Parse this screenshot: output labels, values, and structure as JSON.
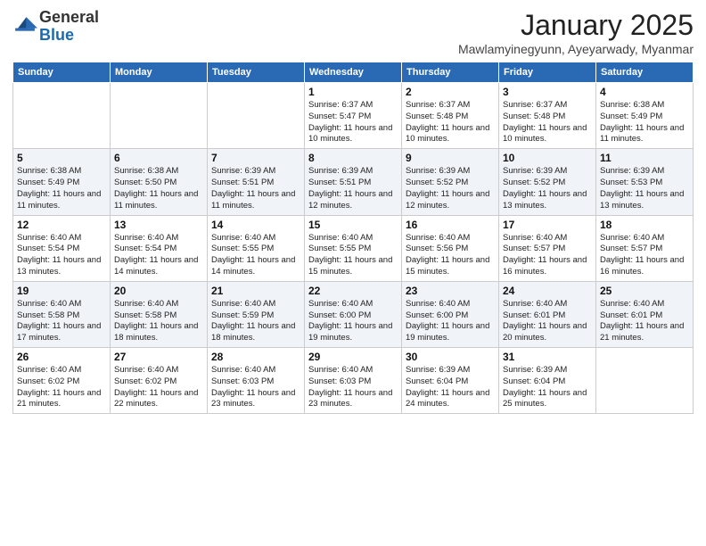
{
  "header": {
    "logo": {
      "general": "General",
      "blue": "Blue"
    },
    "title": "January 2025",
    "location": "Mawlamyinegyunn, Ayeyarwady, Myanmar"
  },
  "days_of_week": [
    "Sunday",
    "Monday",
    "Tuesday",
    "Wednesday",
    "Thursday",
    "Friday",
    "Saturday"
  ],
  "weeks": [
    [
      {
        "day": "",
        "info": ""
      },
      {
        "day": "",
        "info": ""
      },
      {
        "day": "",
        "info": ""
      },
      {
        "day": "1",
        "info": "Sunrise: 6:37 AM\nSunset: 5:47 PM\nDaylight: 11 hours and 10 minutes."
      },
      {
        "day": "2",
        "info": "Sunrise: 6:37 AM\nSunset: 5:48 PM\nDaylight: 11 hours and 10 minutes."
      },
      {
        "day": "3",
        "info": "Sunrise: 6:37 AM\nSunset: 5:48 PM\nDaylight: 11 hours and 10 minutes."
      },
      {
        "day": "4",
        "info": "Sunrise: 6:38 AM\nSunset: 5:49 PM\nDaylight: 11 hours and 11 minutes."
      }
    ],
    [
      {
        "day": "5",
        "info": "Sunrise: 6:38 AM\nSunset: 5:49 PM\nDaylight: 11 hours and 11 minutes."
      },
      {
        "day": "6",
        "info": "Sunrise: 6:38 AM\nSunset: 5:50 PM\nDaylight: 11 hours and 11 minutes."
      },
      {
        "day": "7",
        "info": "Sunrise: 6:39 AM\nSunset: 5:51 PM\nDaylight: 11 hours and 11 minutes."
      },
      {
        "day": "8",
        "info": "Sunrise: 6:39 AM\nSunset: 5:51 PM\nDaylight: 11 hours and 12 minutes."
      },
      {
        "day": "9",
        "info": "Sunrise: 6:39 AM\nSunset: 5:52 PM\nDaylight: 11 hours and 12 minutes."
      },
      {
        "day": "10",
        "info": "Sunrise: 6:39 AM\nSunset: 5:52 PM\nDaylight: 11 hours and 13 minutes."
      },
      {
        "day": "11",
        "info": "Sunrise: 6:39 AM\nSunset: 5:53 PM\nDaylight: 11 hours and 13 minutes."
      }
    ],
    [
      {
        "day": "12",
        "info": "Sunrise: 6:40 AM\nSunset: 5:54 PM\nDaylight: 11 hours and 13 minutes."
      },
      {
        "day": "13",
        "info": "Sunrise: 6:40 AM\nSunset: 5:54 PM\nDaylight: 11 hours and 14 minutes."
      },
      {
        "day": "14",
        "info": "Sunrise: 6:40 AM\nSunset: 5:55 PM\nDaylight: 11 hours and 14 minutes."
      },
      {
        "day": "15",
        "info": "Sunrise: 6:40 AM\nSunset: 5:55 PM\nDaylight: 11 hours and 15 minutes."
      },
      {
        "day": "16",
        "info": "Sunrise: 6:40 AM\nSunset: 5:56 PM\nDaylight: 11 hours and 15 minutes."
      },
      {
        "day": "17",
        "info": "Sunrise: 6:40 AM\nSunset: 5:57 PM\nDaylight: 11 hours and 16 minutes."
      },
      {
        "day": "18",
        "info": "Sunrise: 6:40 AM\nSunset: 5:57 PM\nDaylight: 11 hours and 16 minutes."
      }
    ],
    [
      {
        "day": "19",
        "info": "Sunrise: 6:40 AM\nSunset: 5:58 PM\nDaylight: 11 hours and 17 minutes."
      },
      {
        "day": "20",
        "info": "Sunrise: 6:40 AM\nSunset: 5:58 PM\nDaylight: 11 hours and 18 minutes."
      },
      {
        "day": "21",
        "info": "Sunrise: 6:40 AM\nSunset: 5:59 PM\nDaylight: 11 hours and 18 minutes."
      },
      {
        "day": "22",
        "info": "Sunrise: 6:40 AM\nSunset: 6:00 PM\nDaylight: 11 hours and 19 minutes."
      },
      {
        "day": "23",
        "info": "Sunrise: 6:40 AM\nSunset: 6:00 PM\nDaylight: 11 hours and 19 minutes."
      },
      {
        "day": "24",
        "info": "Sunrise: 6:40 AM\nSunset: 6:01 PM\nDaylight: 11 hours and 20 minutes."
      },
      {
        "day": "25",
        "info": "Sunrise: 6:40 AM\nSunset: 6:01 PM\nDaylight: 11 hours and 21 minutes."
      }
    ],
    [
      {
        "day": "26",
        "info": "Sunrise: 6:40 AM\nSunset: 6:02 PM\nDaylight: 11 hours and 21 minutes."
      },
      {
        "day": "27",
        "info": "Sunrise: 6:40 AM\nSunset: 6:02 PM\nDaylight: 11 hours and 22 minutes."
      },
      {
        "day": "28",
        "info": "Sunrise: 6:40 AM\nSunset: 6:03 PM\nDaylight: 11 hours and 23 minutes."
      },
      {
        "day": "29",
        "info": "Sunrise: 6:40 AM\nSunset: 6:03 PM\nDaylight: 11 hours and 23 minutes."
      },
      {
        "day": "30",
        "info": "Sunrise: 6:39 AM\nSunset: 6:04 PM\nDaylight: 11 hours and 24 minutes."
      },
      {
        "day": "31",
        "info": "Sunrise: 6:39 AM\nSunset: 6:04 PM\nDaylight: 11 hours and 25 minutes."
      },
      {
        "day": "",
        "info": ""
      }
    ]
  ]
}
